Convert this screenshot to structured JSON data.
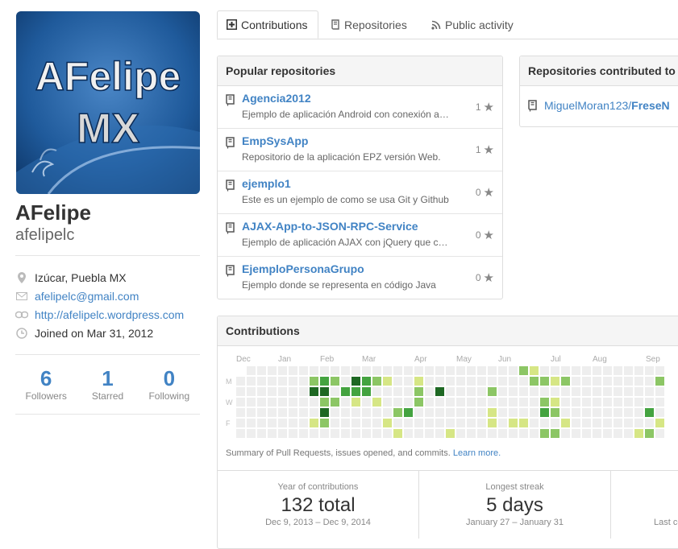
{
  "profile": {
    "avatar_text_top": "AFelipe",
    "avatar_text_bottom": "MX",
    "fullname": "AFelipe",
    "username": "afelipelc",
    "location": "Izúcar, Puebla MX",
    "email": "afelipelc@gmail.com",
    "website": "http://afelipelc.wordpress.com",
    "joined": "Joined on Mar 31, 2012"
  },
  "stats": [
    {
      "num": "6",
      "label": "Followers"
    },
    {
      "num": "1",
      "label": "Starred"
    },
    {
      "num": "0",
      "label": "Following"
    }
  ],
  "tabs": [
    {
      "label": "Contributions",
      "icon": "plus-square-icon",
      "selected": true
    },
    {
      "label": "Repositories",
      "icon": "book-icon",
      "selected": false
    },
    {
      "label": "Public activity",
      "icon": "rss-icon",
      "selected": false
    }
  ],
  "popular": {
    "title": "Popular repositories",
    "repos": [
      {
        "name": "Agencia2012",
        "desc": "Ejemplo de aplicación Android con conexión a WebService",
        "stars": "1"
      },
      {
        "name": "EmpSysApp",
        "desc": "Repositorio de la aplicación EPZ versión Web.",
        "stars": "1"
      },
      {
        "name": "ejemplo1",
        "desc": "Este es un ejemplo de como se usa Git y Github",
        "stars": "0"
      },
      {
        "name": "AJAX-App-to-JSON-RPC-Service",
        "desc": "Ejemplo de aplicación AJAX con jQuery que consume",
        "stars": "0"
      },
      {
        "name": "EjemploPersonaGrupo",
        "desc": "Ejemplo donde se representa en código Java",
        "stars": "0"
      }
    ]
  },
  "contributed": {
    "title": "Repositories contributed to",
    "items": [
      {
        "owner": "MiguelMoran123/",
        "repo": "FreseN"
      }
    ]
  },
  "calendar": {
    "title": "Contributions",
    "months": [
      "Dec",
      "Jan",
      "Feb",
      "Mar",
      "Apr",
      "May",
      "Jun",
      "Jul",
      "Aug",
      "Sep"
    ],
    "days": [
      "M",
      "W",
      "F"
    ],
    "note": "Summary of Pull Requests, issues opened, and commits.",
    "learn_more": "Learn more.",
    "colors": [
      "#eeeeee",
      "#d6e685",
      "#8cc665",
      "#44a340",
      "#1e6823"
    ]
  },
  "summary": [
    {
      "title": "Year of contributions",
      "value": "132 total",
      "range": "Dec 9, 2013 – Dec 9, 2014"
    },
    {
      "title": "Longest streak",
      "value": "5 days",
      "range": "January 27 – January 31"
    },
    {
      "title": "",
      "value": "",
      "range": "Last co"
    }
  ]
}
